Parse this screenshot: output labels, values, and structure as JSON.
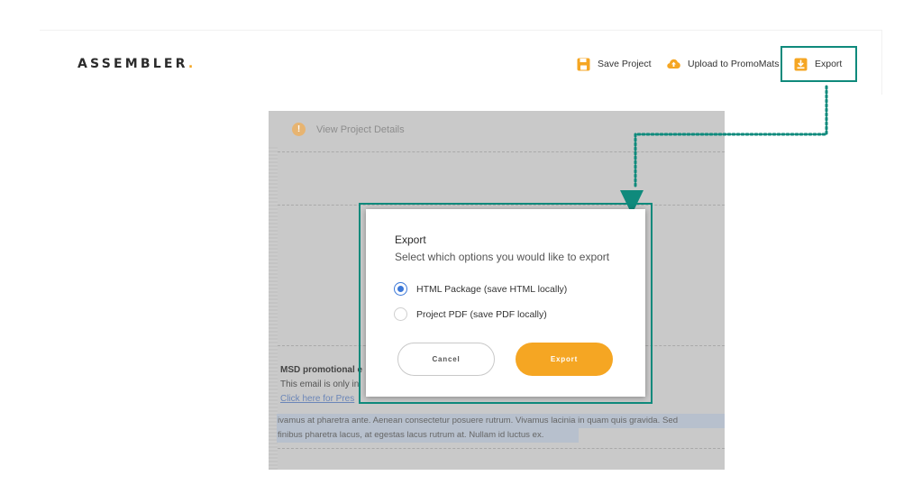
{
  "header": {
    "logo_text": "ASSEMBLER",
    "logo_dot": ".",
    "actions": {
      "save": "Save Project",
      "upload": "Upload to PromoMats",
      "export": "Export"
    }
  },
  "project": {
    "details_label": "View Project Details",
    "msd_title": "MSD promotional e",
    "msd_line": "This email is only in",
    "msd_link": "Click here for Pres",
    "selected_text_1": "ivamus at pharetra ante. Aenean consectetur posuere rutrum. Vivamus lacinia in quam quis gravida. Sed",
    "selected_text_2": "finibus pharetra lacus, at egestas lacus rutrum at. Nullam id luctus ex."
  },
  "dialog": {
    "title": "Export",
    "subtitle": "Select which options you would like to export",
    "options": [
      {
        "label": "HTML Package",
        "hint": "(save HTML locally)",
        "selected": true
      },
      {
        "label": "Project PDF",
        "hint": "(save PDF locally)",
        "selected": false
      }
    ],
    "cancel_label": "Cancel",
    "export_label": "Export"
  },
  "colors": {
    "accent": "#f5a623",
    "highlight": "#0f8a7c",
    "radio_selected": "#3c78d8"
  },
  "icons": {
    "save": "save-icon",
    "upload": "cloud-upload-icon",
    "export": "download-icon",
    "details": "info-icon"
  }
}
